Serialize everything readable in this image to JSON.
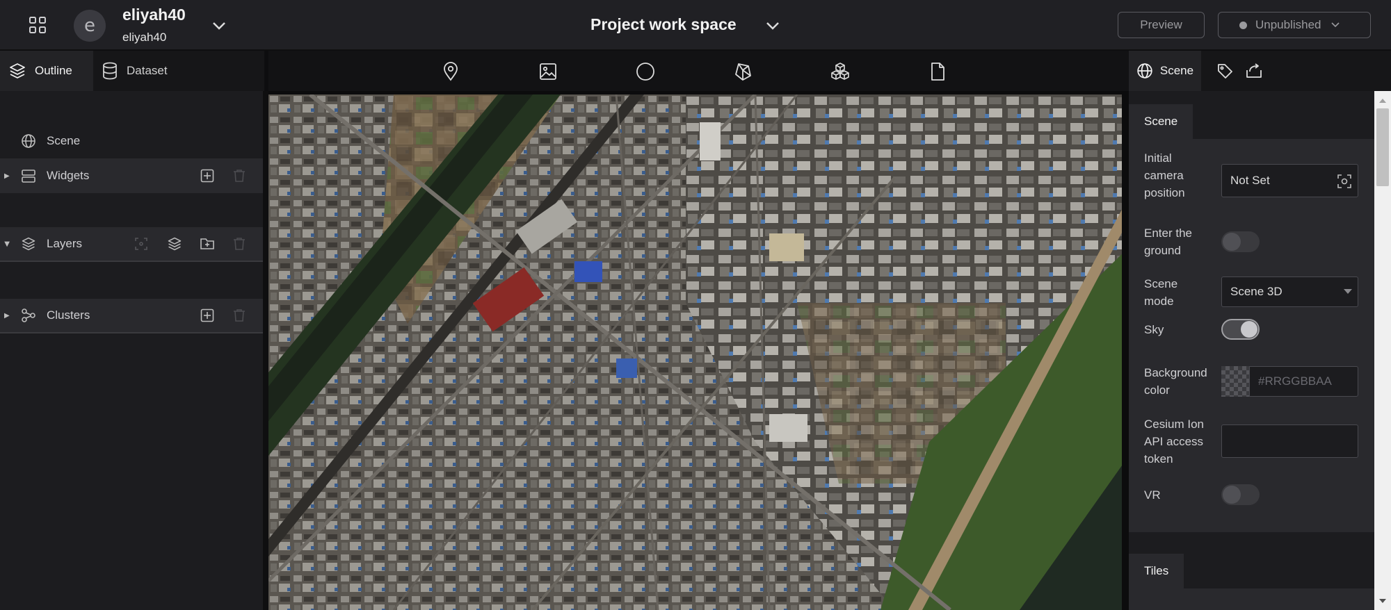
{
  "header": {
    "workspace_name": "eliyah40",
    "workspace_sub": "eliyah40",
    "avatar_letter": "e",
    "project_title": "Project work space",
    "preview_label": "Preview",
    "publish_label": "Unpublished"
  },
  "left_tabs": {
    "outline": "Outline",
    "dataset": "Dataset"
  },
  "outline": {
    "scene": "Scene",
    "widgets": "Widgets",
    "layers": "Layers",
    "clusters": "Clusters"
  },
  "right_tabs": {
    "scene": "Scene"
  },
  "scene_section": {
    "title": "Scene",
    "camera_label_1": "Initial",
    "camera_label_2": "camera",
    "camera_label_3": "position",
    "camera_value": "Not Set",
    "ground_label_1": "Enter the",
    "ground_label_2": "ground",
    "ground_enabled": false,
    "mode_label_1": "Scene",
    "mode_label_2": "mode",
    "mode_value": "Scene 3D",
    "sky_label": "Sky",
    "sky_enabled": true,
    "bg_label_1": "Background",
    "bg_label_2": "color",
    "bg_placeholder": "#RRGGBBAA",
    "token_label_1": "Cesium Ion",
    "token_label_2": "API access",
    "token_label_3": "token",
    "token_value": "",
    "vr_label": "VR",
    "vr_enabled": false
  },
  "tiles_section": {
    "title": "Tiles"
  },
  "colors": {
    "header_bg": "#202024",
    "panel_bg": "#1c1c1f",
    "group_row_bg": "#29292d",
    "map_vegetation": "#3d5a2a",
    "map_river": "#1f2a22",
    "map_embankment": "#a08a6a"
  }
}
